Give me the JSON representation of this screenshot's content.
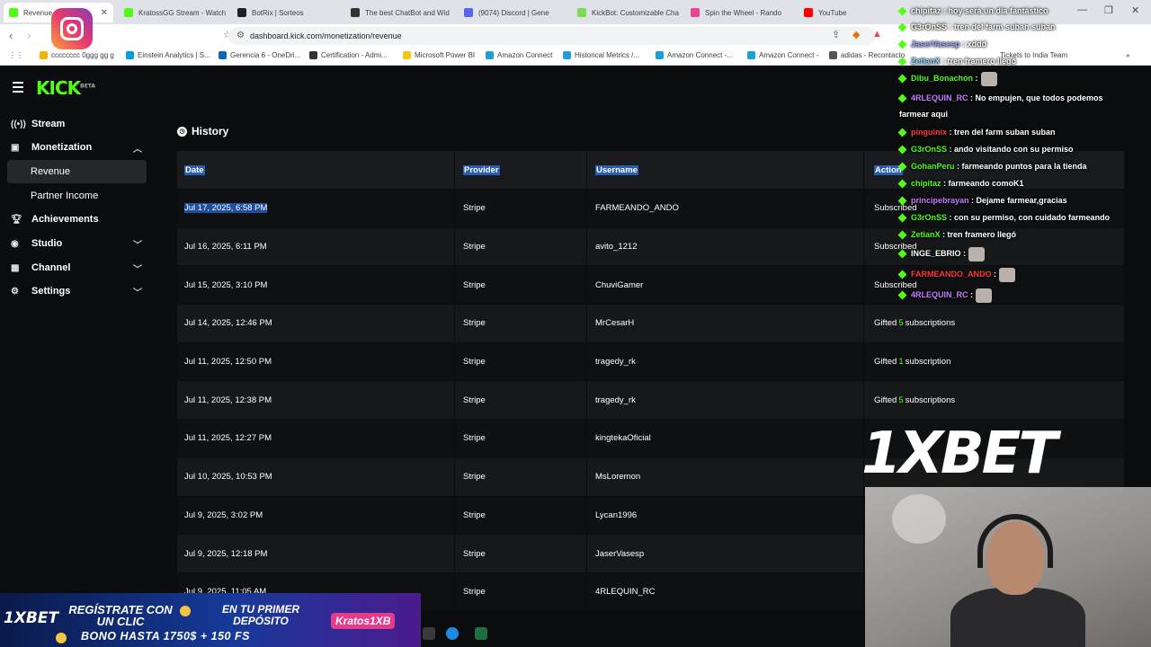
{
  "browser": {
    "tabs": [
      {
        "title": "Revenue",
        "color": "#53fc18",
        "active": true
      },
      {
        "title": "KratossGG Stream - Watch",
        "color": "#53fc18"
      },
      {
        "title": "BotRix | Sorteos",
        "color": "#202124"
      },
      {
        "title": "The best ChatBot and Wid",
        "color": "#333333"
      },
      {
        "title": "(9074) Discord | Gene",
        "color": "#5865f2"
      },
      {
        "title": "KickBot: Customizable Cha",
        "color": "#7ed957"
      },
      {
        "title": "Spin the Wheel - Rando",
        "color": "#e84393"
      },
      {
        "title": "YouTube",
        "color": "#ff0000"
      }
    ],
    "url": "dashboard.kick.com/monetization/revenue",
    "bookmarks": [
      {
        "label": "cccccccc 0ggg gg g",
        "color": "#f4b400"
      },
      {
        "label": "Einstein Analytics | S...",
        "color": "#00a1e0"
      },
      {
        "label": "Gerencia 6 - OneDri...",
        "color": "#0a66c2"
      },
      {
        "label": "Certification - Admi...",
        "color": "#333333"
      },
      {
        "label": "Microsoft Power BI",
        "color": "#f2c811"
      },
      {
        "label": "Amazon Connect",
        "color": "#1ba0d8"
      },
      {
        "label": "Historical Metrics /...",
        "color": "#1ba0d8"
      },
      {
        "label": "Amazon Connect -...",
        "color": "#1ba0d8"
      },
      {
        "label": "Amazon Connect -",
        "color": "#1ba0d8"
      },
      {
        "label": "adidas - Recontacto",
        "color": "#555555"
      }
    ],
    "bookmark_overflow": "Tickets to India Team"
  },
  "app": {
    "logo": "KICK",
    "logo_badge": "BETA",
    "nav": {
      "stream": "Stream",
      "monetization": "Monetization",
      "revenue": "Revenue",
      "partner_income": "Partner Income",
      "achievements": "Achievements",
      "studio": "Studio",
      "channel": "Channel",
      "settings": "Settings"
    },
    "history_title": "History",
    "columns": [
      "Date",
      "Provider",
      "Username",
      "Action"
    ],
    "rows": [
      {
        "date": "Jul 17, 2025, 6:58 PM",
        "provider": "Stripe",
        "username": "FARMEANDO_ANDO",
        "action_pre": "Subscribed",
        "action_num": "",
        "action_post": ""
      },
      {
        "date": "Jul 16, 2025, 6:11 PM",
        "provider": "Stripe",
        "username": "avito_1212",
        "action_pre": "Subscribed",
        "action_num": "",
        "action_post": ""
      },
      {
        "date": "Jul 15, 2025, 3:10 PM",
        "provider": "Stripe",
        "username": "ChuviGamer",
        "action_pre": "Subscribed",
        "action_num": "",
        "action_post": ""
      },
      {
        "date": "Jul 14, 2025, 12:46 PM",
        "provider": "Stripe",
        "username": "MrCesarH",
        "action_pre": "Gifted",
        "action_num": "5",
        "action_post": "subscriptions"
      },
      {
        "date": "Jul 11, 2025, 12:50 PM",
        "provider": "Stripe",
        "username": "tragedy_rk",
        "action_pre": "Gifted",
        "action_num": "1",
        "action_post": "subscription"
      },
      {
        "date": "Jul 11, 2025, 12:38 PM",
        "provider": "Stripe",
        "username": "tragedy_rk",
        "action_pre": "Gifted",
        "action_num": "5",
        "action_post": "subscriptions"
      },
      {
        "date": "Jul 11, 2025, 12:27 PM",
        "provider": "Stripe",
        "username": "kingtekaOficial",
        "action_pre": "",
        "action_num": "",
        "action_post": ""
      },
      {
        "date": "Jul 10, 2025, 10:53 PM",
        "provider": "Stripe",
        "username": "MsLoremon",
        "action_pre": "",
        "action_num": "",
        "action_post": ""
      },
      {
        "date": "Jul 9, 2025, 3:02 PM",
        "provider": "Stripe",
        "username": "Lycan1996",
        "action_pre": "",
        "action_num": "",
        "action_post": ""
      },
      {
        "date": "Jul 9, 2025, 12:18 PM",
        "provider": "Stripe",
        "username": "JaserVasesp",
        "action_pre": "",
        "action_num": "",
        "action_post": ""
      },
      {
        "date": "Jul 9, 2025, 11:05 AM",
        "provider": "Stripe",
        "username": "4RLEQUIN_RC",
        "action_pre": "",
        "action_num": "",
        "action_post": ""
      }
    ]
  },
  "chat": [
    {
      "user": "chipitaz",
      "color": "#ffffff",
      "text": ": hoy será un dia fantástico"
    },
    {
      "user": "G3rOnSS",
      "color": "#ffffff",
      "text": ": tren del farm suban suban"
    },
    {
      "user": "JaserVasesp",
      "color": "#9aa7ff",
      "text": ": xddd"
    },
    {
      "user": "ZetianX",
      "color": "#7ed3ff",
      "text": ": tren framero llegó"
    },
    {
      "user": "Dibu_Bonachon",
      "color": "#53fc18",
      "text": ":"
    },
    {
      "user": "4RLEQUIN_RC",
      "color": "#c77dff",
      "text": ": No empujen, que todos podemos"
    },
    {
      "user": "",
      "color": "#ffffff",
      "text": "farmear aqui"
    },
    {
      "user": "pinguinix",
      "color": "#ff3b3b",
      "text": ": tren del farm suban suban"
    },
    {
      "user": "G3rOnSS",
      "color": "#53fc18",
      "text": ": ando visitando con su permiso"
    },
    {
      "user": "GohanPeru",
      "color": "#53fc18",
      "text": ": farmeando puntos para la tienda"
    },
    {
      "user": "chipitaz",
      "color": "#53fc18",
      "text": ": farmeando comoK1"
    },
    {
      "user": "principebrayan",
      "color": "#c77dff",
      "text": ": Dejame farmear,gracias"
    },
    {
      "user": "G3rOnSS",
      "color": "#53fc18",
      "text": ": con su permiso, con cuidado farmeando"
    },
    {
      "user": "ZetianX",
      "color": "#53fc18",
      "text": ": tren framero llegó"
    },
    {
      "user": "INGE_EBRIO",
      "color": "#ffffff",
      "text": ":"
    },
    {
      "user": "FARMEANDO_ANDO",
      "color": "#ff3b3b",
      "text": ":"
    },
    {
      "user": "4RLEQUIN_RC",
      "color": "#c77dff",
      "text": ":"
    }
  ],
  "overlay": {
    "sponsor": "1XBET",
    "promo_logo": "1XBET",
    "promo_line1": "REGÍSTRATE CON UN CLIC",
    "promo_line2": "EN TU PRIMER DEPÓSITO",
    "promo_line3": "BONO HASTA 1750$ + 150 FS",
    "promo_code": "Kratos1XB"
  }
}
